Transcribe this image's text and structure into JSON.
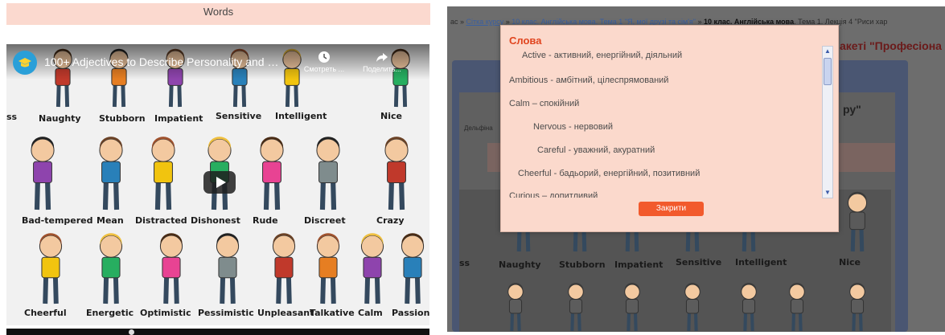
{
  "left": {
    "words_header": "Words",
    "video": {
      "title": "100+ Adjectives to Describe Personality and Char...",
      "watch_label": "Смотреть ...",
      "share_label": "Поделить...",
      "labels_row1": [
        "ss",
        "Naughty",
        "Stubborn",
        "Impatient",
        "Sensitive",
        "Intelligent",
        "Nice"
      ],
      "labels_row2": [
        "Bad-tempered",
        "Mean",
        "Distracted",
        "Dishonest",
        "Rude",
        "Discreet",
        "Crazy"
      ],
      "labels_row3": [
        "Cheerful",
        "Energetic",
        "Optimistic",
        "Pessimistic",
        "Unpleasant",
        "Talkative",
        "Calm",
        "Passion"
      ]
    }
  },
  "right": {
    "breadcrumb": {
      "prefix": "ас »",
      "link1": "Сітка курсу",
      "link2": "10 клас. Англійська мова. Тема 1 \"Я, мої друзі та сім'я\"",
      "bold": "10 клас. Англійська мова",
      "suffix": ". Тема 1. Лекція 4 \"Риси хар"
    },
    "heading": "акеті \"Професіона",
    "quote": "ру\"",
    "small_text": "Дельфіна",
    "video_labels": [
      "ss",
      "Naughty",
      "Stubborn",
      "Impatient",
      "Sensitive",
      "Intelligent",
      "Nice"
    ]
  },
  "modal": {
    "title": "Слова",
    "items": [
      "Active - активний, енергійний, діяльний",
      "Ambitious - амбітний, цілеспрямований",
      "Calm – спокійний",
      "Nervous - нервовий",
      "Careful - уважний, акуратний",
      "Cheerful - бадьорий, енергійний, позитивний",
      "Curious – допитливий"
    ],
    "close_label": "Закрити",
    "colors": {
      "title": "#e0451f",
      "button": "#f25a2c",
      "background": "#fbd9cc"
    }
  }
}
